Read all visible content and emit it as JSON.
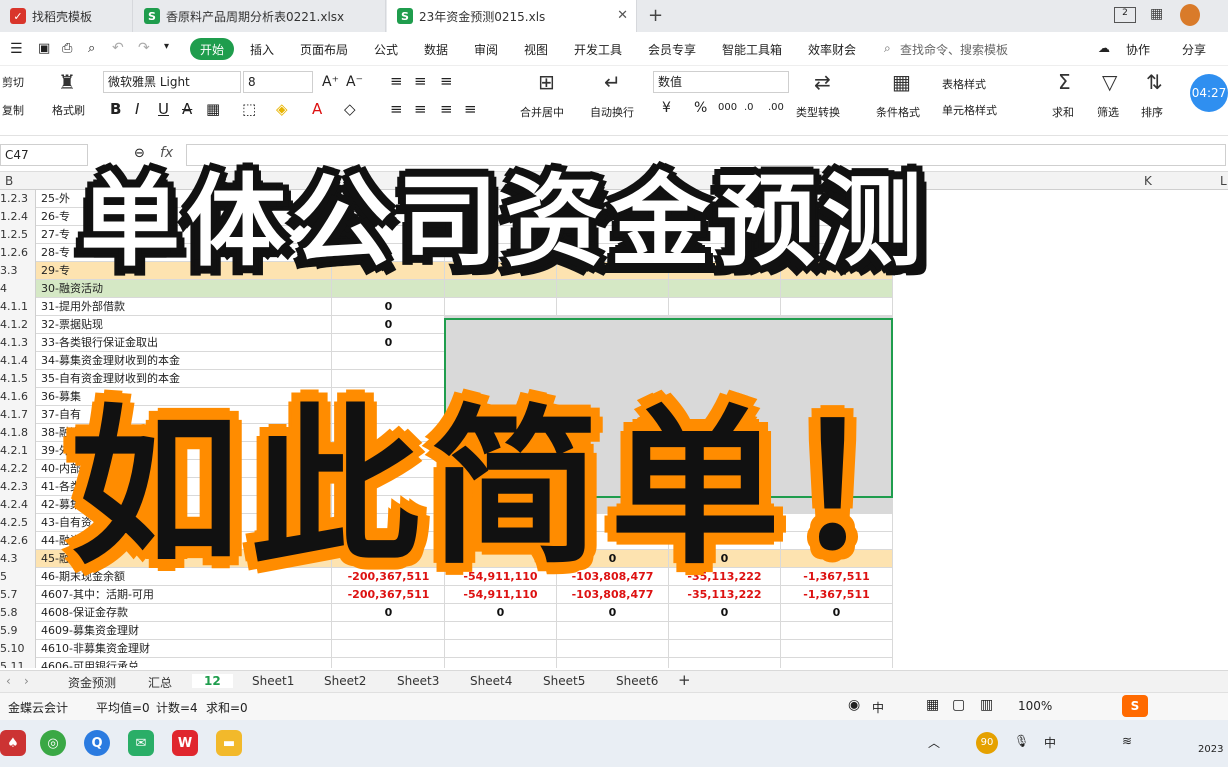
{
  "tabs": [
    {
      "label": "找稻壳模板",
      "icon": "docer-icon"
    },
    {
      "label": "香原料产品周期分析表0221.xlsx",
      "icon": "sheet-icon"
    },
    {
      "label": "23年资金预测0215.xls",
      "icon": "sheet-icon"
    }
  ],
  "menu": [
    "开始",
    "插入",
    "页面布局",
    "公式",
    "数据",
    "审阅",
    "视图",
    "开发工具",
    "会员专享",
    "智能工具箱",
    "效率财会"
  ],
  "search_placeholder": "查找命令、搜索模板",
  "collab": "协作",
  "share": "分享",
  "ribbon": {
    "cut": "剪切",
    "copy": "复制",
    "format_painter": "格式刷",
    "font_name": "微软雅黑 Light",
    "font_size": "8",
    "merge": "合并居中",
    "wrap": "自动换行",
    "number_format": "数值",
    "convert": "类型转换",
    "cond_format": "条件格式",
    "table_style": "表格样式",
    "cell_style": "单元格样式",
    "sum": "求和",
    "filter": "筛选",
    "sort": "排序",
    "time": "04:27"
  },
  "name_box": "C47",
  "fx": "fx",
  "columns": [
    "B",
    "K",
    "L"
  ],
  "rows": [
    {
      "h": "1.2.3",
      "label": "25-外",
      "vals": [
        "",
        "",
        "",
        "",
        ""
      ],
      "style": ""
    },
    {
      "h": "1.2.4",
      "label": "26-专",
      "vals": [
        "",
        "",
        "",
        "",
        ""
      ],
      "style": ""
    },
    {
      "h": "1.2.5",
      "label": "27-专",
      "vals": [
        "",
        "",
        "",
        "",
        ""
      ],
      "style": ""
    },
    {
      "h": "1.2.6",
      "label": "28-专",
      "vals": [
        "",
        "",
        "",
        "",
        ""
      ],
      "style": ""
    },
    {
      "h": "3.3",
      "label": "29-专",
      "vals": [
        "",
        "",
        "",
        "",
        ""
      ],
      "style": "orange"
    },
    {
      "h": "4",
      "label": "30-融资活动",
      "vals": [
        "",
        "",
        "",
        "",
        ""
      ],
      "style": "green"
    },
    {
      "h": "4.1.1",
      "label": "31-提用外部借款",
      "vals": [
        "0",
        "",
        "",
        "",
        ""
      ],
      "style": ""
    },
    {
      "h": "4.1.2",
      "label": "32-票据贴现",
      "vals": [
        "0",
        "",
        "",
        "",
        ""
      ],
      "style": ""
    },
    {
      "h": "4.1.3",
      "label": "33-各类银行保证金取出",
      "vals": [
        "0",
        "",
        "",
        "",
        ""
      ],
      "style": ""
    },
    {
      "h": "4.1.4",
      "label": "34-募集资金理财收到的本金",
      "vals": [
        "",
        "",
        "",
        "",
        ""
      ],
      "style": ""
    },
    {
      "h": "4.1.5",
      "label": "35-自有资金理财收到的本金",
      "vals": [
        "",
        "",
        "",
        "",
        ""
      ],
      "style": ""
    },
    {
      "h": "4.1.6",
      "label": "36-募集",
      "vals": [
        "",
        "",
        "",
        "",
        ""
      ],
      "style": ""
    },
    {
      "h": "4.1.7",
      "label": "37-自有",
      "vals": [
        "",
        "",
        "",
        "",
        ""
      ],
      "style": ""
    },
    {
      "h": "4.1.8",
      "label": "38-融资",
      "vals": [
        "",
        "",
        "",
        "",
        ""
      ],
      "style": ""
    },
    {
      "h": "4.2.1",
      "label": "39-外部",
      "vals": [
        "",
        "",
        "",
        "",
        ""
      ],
      "style": ""
    },
    {
      "h": "4.2.2",
      "label": "40-内部",
      "vals": [
        "",
        "",
        "",
        "",
        ""
      ],
      "style": ""
    },
    {
      "h": "4.2.3",
      "label": "41-各类",
      "vals": [
        "",
        "",
        "",
        "",
        ""
      ],
      "style": ""
    },
    {
      "h": "4.2.4",
      "label": "42-募集",
      "vals": [
        "",
        "",
        "",
        "",
        ""
      ],
      "style": ""
    },
    {
      "h": "4.2.5",
      "label": "43-自有资金",
      "vals": [
        "",
        "",
        "",
        "",
        ""
      ],
      "style": ""
    },
    {
      "h": "4.2.6",
      "label": "44-融资与",
      "vals": [
        "",
        "",
        "",
        "",
        ""
      ],
      "style": ""
    },
    {
      "h": "4.3",
      "label": "45-融资与",
      "vals": [
        "",
        "",
        "0",
        "0",
        ""
      ],
      "style": "orange"
    },
    {
      "h": "5",
      "label": "46-期末现金余额",
      "vals": [
        "-200,367,511",
        "-54,911,110",
        "-103,808,477",
        "-35,113,222",
        "-1,367,511"
      ],
      "style": ""
    },
    {
      "h": "5.7",
      "label": "4607-其中：活期-可用",
      "vals": [
        "-200,367,511",
        "-54,911,110",
        "-103,808,477",
        "-35,113,222",
        "-1,367,511"
      ],
      "style": ""
    },
    {
      "h": "5.8",
      "label": "4608-保证金存款",
      "vals": [
        "0",
        "0",
        "0",
        "0",
        "0"
      ],
      "style": ""
    },
    {
      "h": "5.9",
      "label": "4609-募集资金理财",
      "vals": [
        "",
        "",
        "",
        "",
        ""
      ],
      "style": ""
    },
    {
      "h": "5.10",
      "label": "4610-非募集资金理财",
      "vals": [
        "",
        "",
        "",
        "",
        ""
      ],
      "style": ""
    },
    {
      "h": "5.11",
      "label": "4606-可用银行承兑",
      "vals": [
        "",
        "",
        "",
        "",
        ""
      ],
      "style": ""
    }
  ],
  "sheets": [
    "资金预测",
    "汇总",
    "12",
    "Sheet1",
    "Sheet2",
    "Sheet3",
    "Sheet4",
    "Sheet5",
    "Sheet6"
  ],
  "status": {
    "plugin": "金蝶云会计",
    "avg": "平均值=0",
    "count": "计数=4",
    "sum": "求和=0",
    "zoom": "100%",
    "lang": "中"
  },
  "taskbar": {
    "lang": "中",
    "year": "2023",
    "badge": "90"
  },
  "overlay": {
    "line1": "单体公司资金预测",
    "line2": "如此简单！"
  },
  "colors": {
    "accent": "#1f9d4d",
    "orange": "#ff8c00"
  }
}
